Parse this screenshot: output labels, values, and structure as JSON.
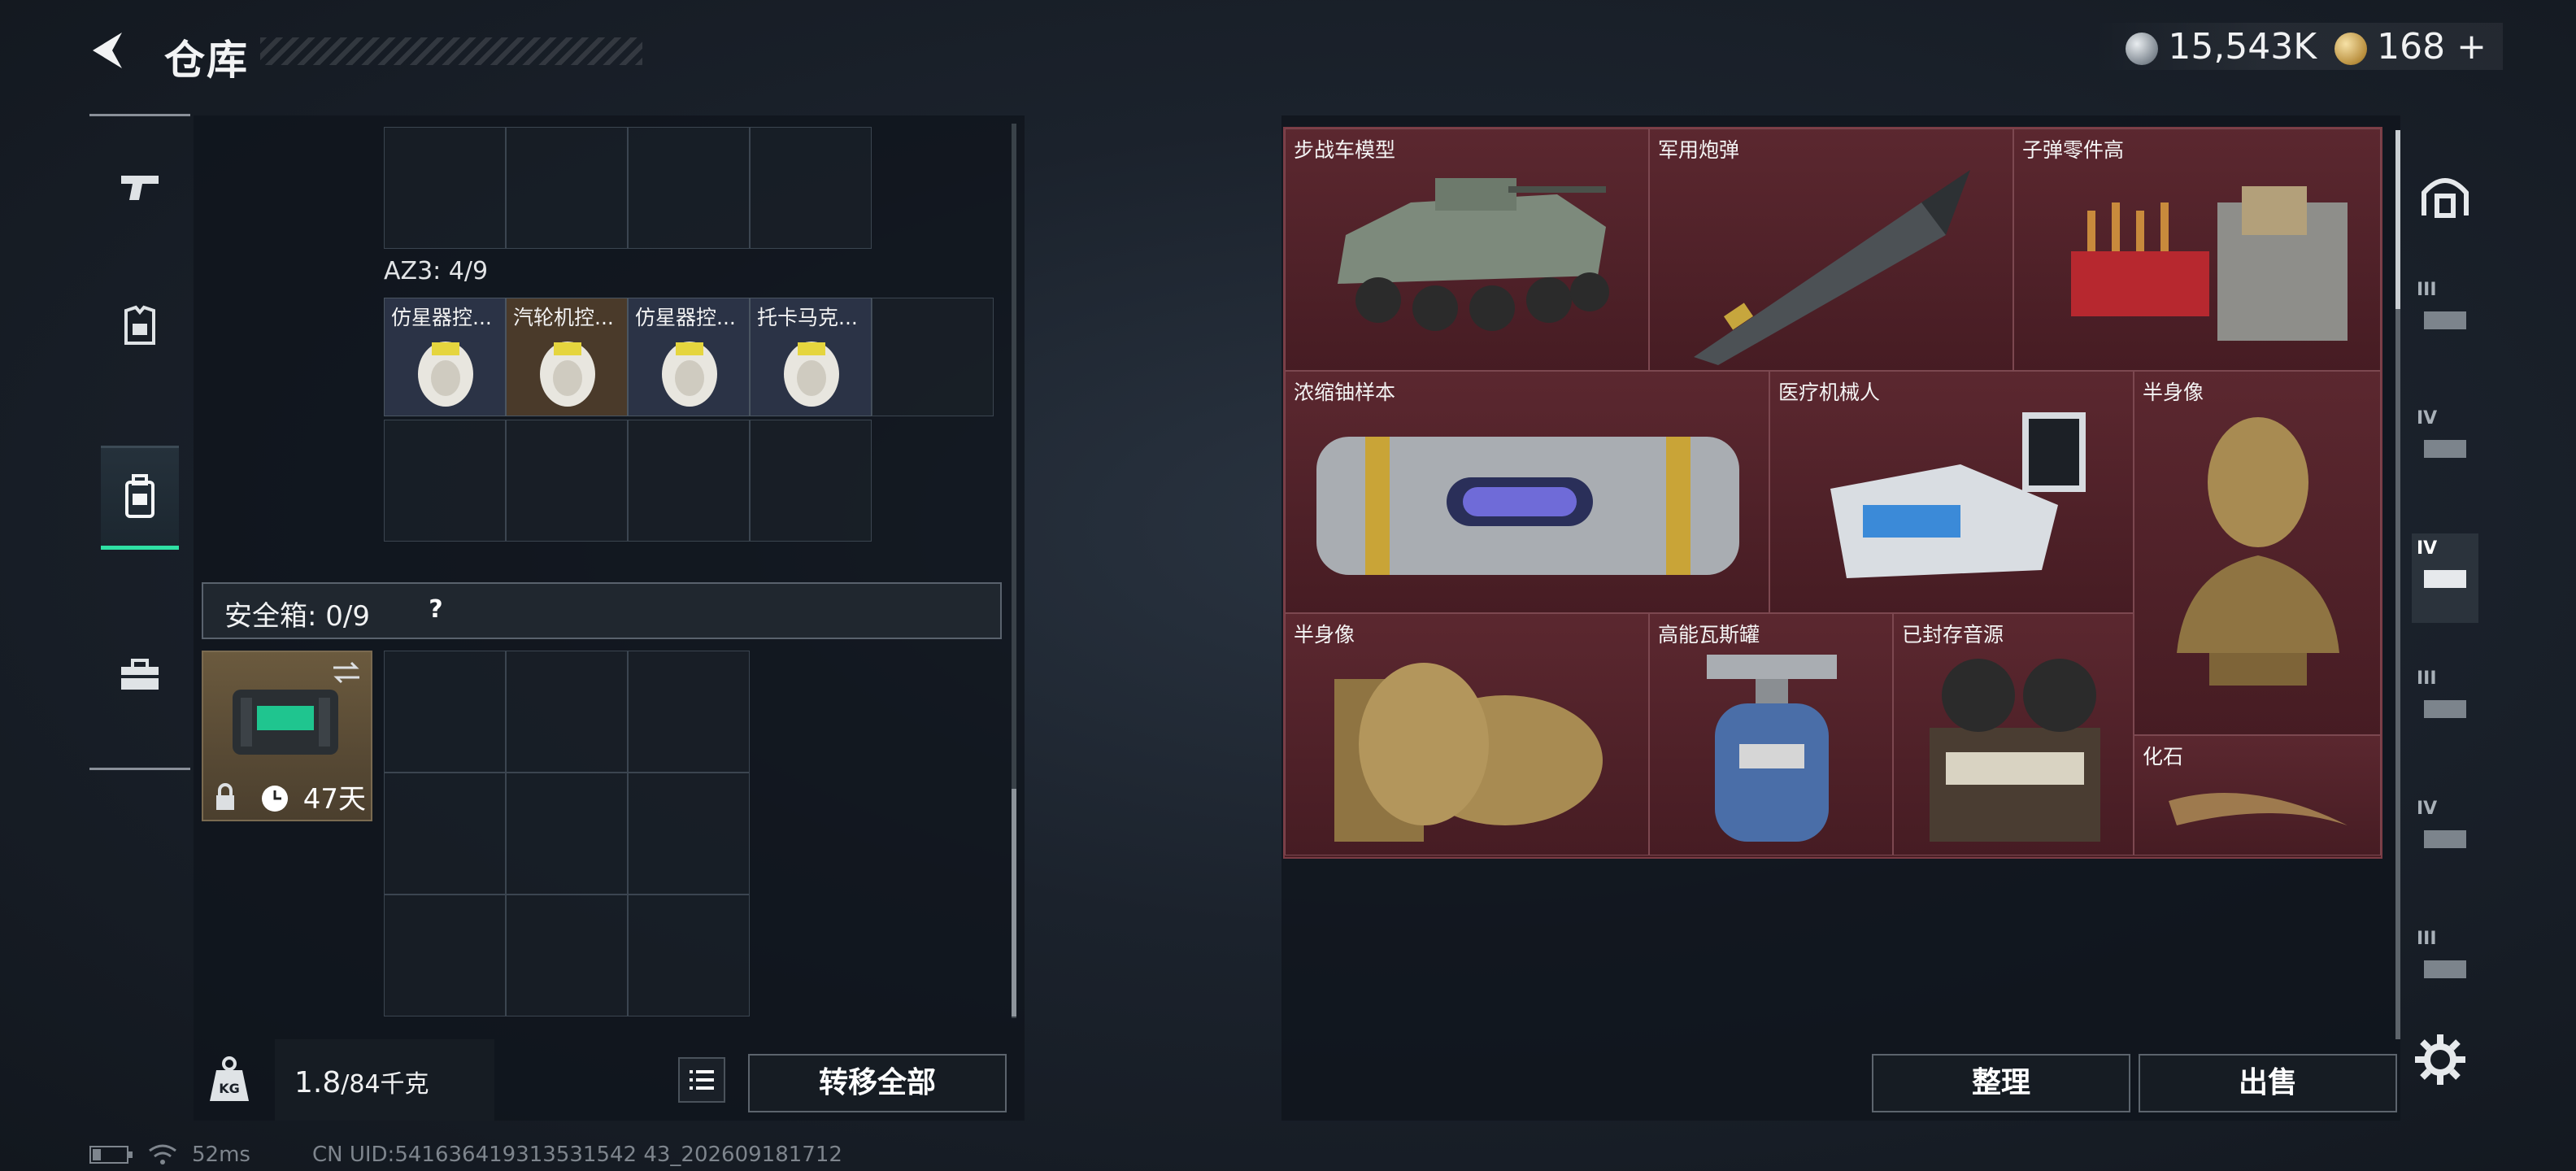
{
  "header": {
    "title": "仓库"
  },
  "currency": {
    "silver": "15,543K",
    "gold": "168",
    "gold_plus": "+"
  },
  "left_rail": {
    "items": [
      "weapon-tab",
      "armor-tab",
      "backpack-tab",
      "medkit-tab"
    ]
  },
  "stash": {
    "az3_label": "AZ3: 4/9",
    "items": [
      "仿星器控...",
      "汽轮机控...",
      "仿星器控...",
      "托卡马克..."
    ],
    "safe_label": "安全箱: 0/9",
    "safe_help": "?",
    "case_days": "47天"
  },
  "bottom_left": {
    "weight_value": "1.8",
    "weight_max": "/84千克",
    "transfer_all": "转移全部"
  },
  "loot": {
    "items": [
      "步战车模型",
      "军用炮弹",
      "子弹零件高",
      "浓缩铀样本",
      "医疗机械人",
      "半身像",
      "半身像",
      "高能瓦斯罐",
      "已封存音源",
      "化石"
    ]
  },
  "right_actions": {
    "organize": "整理",
    "sell": "出售"
  },
  "right_rail": {
    "tiers": [
      "III",
      "IV",
      "IV",
      "III",
      "IV",
      "III"
    ]
  },
  "status": {
    "ping": "52ms",
    "uid": "CN UID:541636419313531542 43_202609181712"
  },
  "colors": {
    "accent": "#2fe0a4",
    "loot_bg": "#4a1f25"
  }
}
